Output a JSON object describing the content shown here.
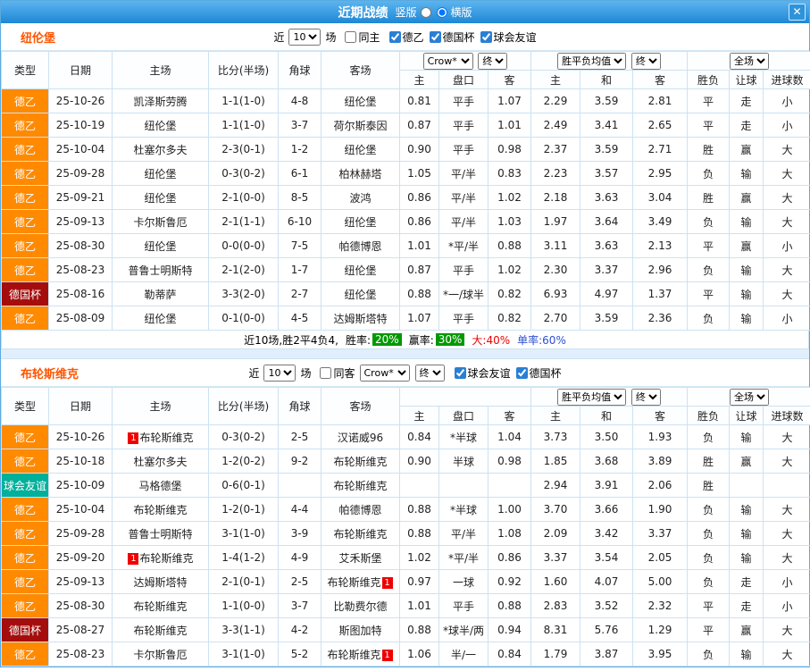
{
  "window": {
    "title": "近期战绩",
    "layout_options": [
      {
        "label": "竖版",
        "selected": false
      },
      {
        "label": "横版",
        "selected": true
      }
    ],
    "close_icon": "✕"
  },
  "columns": {
    "type": "类型",
    "date": "日期",
    "home": "主场",
    "score": "比分(半场)",
    "corner": "角球",
    "away": "客场",
    "asia_home": "主",
    "handicap": "盘口",
    "asia_away": "客",
    "eu_home": "主",
    "eu_draw": "和",
    "eu_away": "客",
    "wdl": "胜负",
    "let_goal": "让球",
    "goals": "进球数"
  },
  "selects": {
    "bookmaker": "Crow*",
    "final": "终",
    "avg": "胜平负均值",
    "scope": "全场"
  },
  "sections": [
    {
      "team": "纽伦堡",
      "filter": {
        "near_label": "近",
        "count": "10",
        "games_label": "场",
        "same": {
          "label": "同主",
          "checked": false
        },
        "competitions": [
          {
            "label": "德乙",
            "checked": true
          },
          {
            "label": "德国杯",
            "checked": true
          },
          {
            "label": "球会友谊",
            "checked": true
          }
        ]
      },
      "rows": [
        {
          "type": "德乙",
          "date": "25-10-26",
          "home": "凯泽斯劳腾",
          "home_focus": false,
          "home_badge": "",
          "score": "1-1(1-0)",
          "corner": "4-8",
          "away": "纽伦堡",
          "away_focus": true,
          "away_badge": "",
          "asia": [
            "0.81",
            "平手",
            "1.07"
          ],
          "eu": [
            "2.29",
            "3.59",
            "2.81"
          ],
          "results": [
            "平",
            "走",
            "小"
          ]
        },
        {
          "type": "德乙",
          "date": "25-10-19",
          "home": "纽伦堡",
          "home_focus": true,
          "home_badge": "",
          "score": "1-1(1-0)",
          "corner": "3-7",
          "away": "荷尔斯泰因",
          "away_focus": false,
          "away_badge": "",
          "asia": [
            "0.87",
            "平手",
            "1.01"
          ],
          "eu": [
            "2.49",
            "3.41",
            "2.65"
          ],
          "results": [
            "平",
            "走",
            "小"
          ]
        },
        {
          "type": "德乙",
          "date": "25-10-04",
          "home": "杜塞尔多夫",
          "home_focus": false,
          "home_badge": "",
          "score": "2-3(0-1)",
          "corner": "1-2",
          "away": "纽伦堡",
          "away_focus": true,
          "away_badge": "",
          "asia": [
            "0.90",
            "平手",
            "0.98"
          ],
          "eu": [
            "2.37",
            "3.59",
            "2.71"
          ],
          "results": [
            "胜",
            "赢",
            "大"
          ]
        },
        {
          "type": "德乙",
          "date": "25-09-28",
          "home": "纽伦堡",
          "home_focus": true,
          "home_badge": "",
          "score": "0-3(0-2)",
          "corner": "6-1",
          "away": "柏林赫塔",
          "away_focus": false,
          "away_badge": "",
          "asia": [
            "1.05",
            "平/半",
            "0.83"
          ],
          "eu": [
            "2.23",
            "3.57",
            "2.95"
          ],
          "results": [
            "负",
            "输",
            "大"
          ]
        },
        {
          "type": "德乙",
          "date": "25-09-21",
          "home": "纽伦堡",
          "home_focus": true,
          "home_badge": "",
          "score": "2-1(0-0)",
          "corner": "8-5",
          "away": "波鸿",
          "away_focus": false,
          "away_badge": "",
          "asia": [
            "0.86",
            "平/半",
            "1.02"
          ],
          "eu": [
            "2.18",
            "3.63",
            "3.04"
          ],
          "results": [
            "胜",
            "赢",
            "大"
          ]
        },
        {
          "type": "德乙",
          "date": "25-09-13",
          "home": "卡尔斯鲁厄",
          "home_focus": false,
          "home_badge": "",
          "score": "2-1(1-1)",
          "corner": "6-10",
          "away": "纽伦堡",
          "away_focus": true,
          "away_badge": "",
          "asia": [
            "0.86",
            "平/半",
            "1.03"
          ],
          "eu": [
            "1.97",
            "3.64",
            "3.49"
          ],
          "results": [
            "负",
            "输",
            "大"
          ]
        },
        {
          "type": "德乙",
          "date": "25-08-30",
          "home": "纽伦堡",
          "home_focus": true,
          "home_badge": "",
          "score": "0-0(0-0)",
          "corner": "7-5",
          "away": "帕德博恩",
          "away_focus": false,
          "away_badge": "",
          "asia": [
            "1.01",
            "*平/半",
            "0.88"
          ],
          "eu": [
            "3.11",
            "3.63",
            "2.13"
          ],
          "results": [
            "平",
            "赢",
            "小"
          ]
        },
        {
          "type": "德乙",
          "date": "25-08-23",
          "home": "普鲁士明斯特",
          "home_focus": false,
          "home_badge": "",
          "score": "2-1(2-0)",
          "corner": "1-7",
          "away": "纽伦堡",
          "away_focus": true,
          "away_badge": "",
          "asia": [
            "0.87",
            "平手",
            "1.02"
          ],
          "eu": [
            "2.30",
            "3.37",
            "2.96"
          ],
          "results": [
            "负",
            "输",
            "大"
          ]
        },
        {
          "type": "德国杯",
          "date": "25-08-16",
          "home": "勒蒂萨",
          "home_focus": false,
          "home_badge": "",
          "score": "3-3(2-0)",
          "corner": "2-7",
          "away": "纽伦堡",
          "away_focus": true,
          "away_badge": "",
          "asia": [
            "0.88",
            "*一/球半",
            "0.82"
          ],
          "eu": [
            "6.93",
            "4.97",
            "1.37"
          ],
          "results": [
            "平",
            "输",
            "大"
          ]
        },
        {
          "type": "德乙",
          "date": "25-08-09",
          "home": "纽伦堡",
          "home_focus": true,
          "home_badge": "",
          "score": "0-1(0-0)",
          "corner": "4-5",
          "away": "达姆斯塔特",
          "away_focus": false,
          "away_badge": "",
          "asia": [
            "1.07",
            "平手",
            "0.82"
          ],
          "eu": [
            "2.70",
            "3.59",
            "2.36"
          ],
          "results": [
            "负",
            "输",
            "小"
          ]
        }
      ],
      "summary": {
        "prefix": "近10场,胜2平4负4,",
        "win_rate_label": "胜率:",
        "win_rate": "20%",
        "profit_rate_label": "赢率:",
        "profit_rate": "30%",
        "big_text": "大:40%",
        "single_text": "单率:60%"
      }
    },
    {
      "team": "布轮斯维克",
      "filter": {
        "near_label": "近",
        "count": "10",
        "games_label": "场",
        "same": {
          "label": "同客",
          "checked": false
        },
        "competitions": [
          {
            "label": "球会友谊",
            "checked": true
          },
          {
            "label": "德国杯",
            "checked": true
          }
        ]
      },
      "rows": [
        {
          "type": "德乙",
          "date": "25-10-26",
          "home": "布轮斯维克",
          "home_focus": true,
          "home_badge": "1",
          "score": "0-3(0-2)",
          "corner": "2-5",
          "away": "汉诺威96",
          "away_focus": false,
          "away_badge": "",
          "asia": [
            "0.84",
            "*半球",
            "1.04"
          ],
          "eu": [
            "3.73",
            "3.50",
            "1.93"
          ],
          "results": [
            "负",
            "输",
            "大"
          ]
        },
        {
          "type": "德乙",
          "date": "25-10-18",
          "home": "杜塞尔多夫",
          "home_focus": false,
          "home_badge": "",
          "score": "1-2(0-2)",
          "corner": "9-2",
          "away": "布轮斯维克",
          "away_focus": true,
          "away_badge": "",
          "asia": [
            "0.90",
            "半球",
            "0.98"
          ],
          "eu": [
            "1.85",
            "3.68",
            "3.89"
          ],
          "results": [
            "胜",
            "赢",
            "大"
          ]
        },
        {
          "type": "球会友谊",
          "date": "25-10-09",
          "home": "马格德堡",
          "home_focus": false,
          "home_badge": "",
          "score": "0-6(0-1)",
          "corner": "",
          "away": "布轮斯维克",
          "away_focus": true,
          "away_badge": "",
          "asia": [
            "",
            "",
            ""
          ],
          "eu": [
            "2.94",
            "3.91",
            "2.06"
          ],
          "results": [
            "胜",
            "",
            ""
          ]
        },
        {
          "type": "德乙",
          "date": "25-10-04",
          "home": "布轮斯维克",
          "home_focus": true,
          "home_badge": "",
          "score": "1-2(0-1)",
          "corner": "4-4",
          "away": "帕德博恩",
          "away_focus": false,
          "away_badge": "",
          "asia": [
            "0.88",
            "*半球",
            "1.00"
          ],
          "eu": [
            "3.70",
            "3.66",
            "1.90"
          ],
          "results": [
            "负",
            "输",
            "大"
          ]
        },
        {
          "type": "德乙",
          "date": "25-09-28",
          "home": "普鲁士明斯特",
          "home_focus": false,
          "home_badge": "",
          "score": "3-1(1-0)",
          "corner": "3-9",
          "away": "布轮斯维克",
          "away_focus": true,
          "away_badge": "",
          "asia": [
            "0.88",
            "平/半",
            "1.08"
          ],
          "eu": [
            "2.09",
            "3.42",
            "3.37"
          ],
          "results": [
            "负",
            "输",
            "大"
          ]
        },
        {
          "type": "德乙",
          "date": "25-09-20",
          "home": "布轮斯维克",
          "home_focus": true,
          "home_badge": "1",
          "score": "1-4(1-2)",
          "corner": "4-9",
          "away": "艾禾斯堡",
          "away_focus": false,
          "away_badge": "",
          "asia": [
            "1.02",
            "*平/半",
            "0.86"
          ],
          "eu": [
            "3.37",
            "3.54",
            "2.05"
          ],
          "results": [
            "负",
            "输",
            "大"
          ]
        },
        {
          "type": "德乙",
          "date": "25-09-13",
          "home": "达姆斯塔特",
          "home_focus": false,
          "home_badge": "",
          "score": "2-1(0-1)",
          "corner": "2-5",
          "away": "布轮斯维克",
          "away_focus": true,
          "away_badge": "1",
          "asia": [
            "0.97",
            "一球",
            "0.92"
          ],
          "eu": [
            "1.60",
            "4.07",
            "5.00"
          ],
          "results": [
            "负",
            "走",
            "小"
          ]
        },
        {
          "type": "德乙",
          "date": "25-08-30",
          "home": "布轮斯维克",
          "home_focus": true,
          "home_badge": "",
          "score": "1-1(0-0)",
          "corner": "3-7",
          "away": "比勒费尔德",
          "away_focus": false,
          "away_badge": "",
          "asia": [
            "1.01",
            "平手",
            "0.88"
          ],
          "eu": [
            "2.83",
            "3.52",
            "2.32"
          ],
          "results": [
            "平",
            "走",
            "小"
          ]
        },
        {
          "type": "德国杯",
          "date": "25-08-27",
          "home": "布轮斯维克",
          "home_focus": true,
          "home_badge": "",
          "score": "3-3(1-1)",
          "corner": "4-2",
          "away": "斯图加特",
          "away_focus": false,
          "away_badge": "",
          "asia": [
            "0.88",
            "*球半/两",
            "0.94"
          ],
          "eu": [
            "8.31",
            "5.76",
            "1.29"
          ],
          "results": [
            "平",
            "赢",
            "大"
          ]
        },
        {
          "type": "德乙",
          "date": "25-08-23",
          "home": "卡尔斯鲁厄",
          "home_focus": false,
          "home_badge": "",
          "score": "3-1(1-0)",
          "corner": "5-2",
          "away": "布轮斯维克",
          "away_focus": true,
          "away_badge": "1",
          "asia": [
            "1.06",
            "半/一",
            "0.84"
          ],
          "eu": [
            "1.79",
            "3.87",
            "3.95"
          ],
          "results": [
            "负",
            "输",
            "大"
          ]
        }
      ]
    }
  ]
}
